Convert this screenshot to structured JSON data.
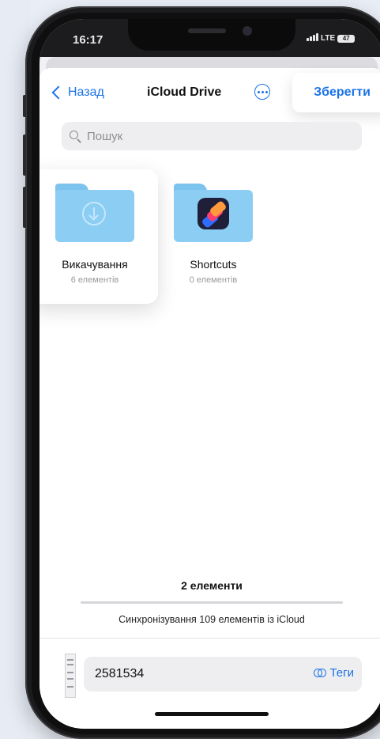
{
  "status_bar": {
    "time": "16:17",
    "network": "LTE",
    "battery": "47"
  },
  "nav": {
    "back_label": "Назад",
    "title": "iCloud Drive",
    "save_label": "Зберегти"
  },
  "search": {
    "placeholder": "Пошук"
  },
  "folders": [
    {
      "name": "Викачування",
      "count": "6 елементів",
      "icon": "download-icon"
    },
    {
      "name": "Shortcuts",
      "count": "0 елементів",
      "icon": "shortcuts-app-icon"
    }
  ],
  "footer": {
    "items_count": "2 елементи",
    "sync_status": "Синхронізування 109 елементів із iCloud",
    "filename": "2581534",
    "tags_label": "Теги"
  },
  "colors": {
    "accent": "#1a73e8",
    "folder": "#8bcdf3"
  }
}
